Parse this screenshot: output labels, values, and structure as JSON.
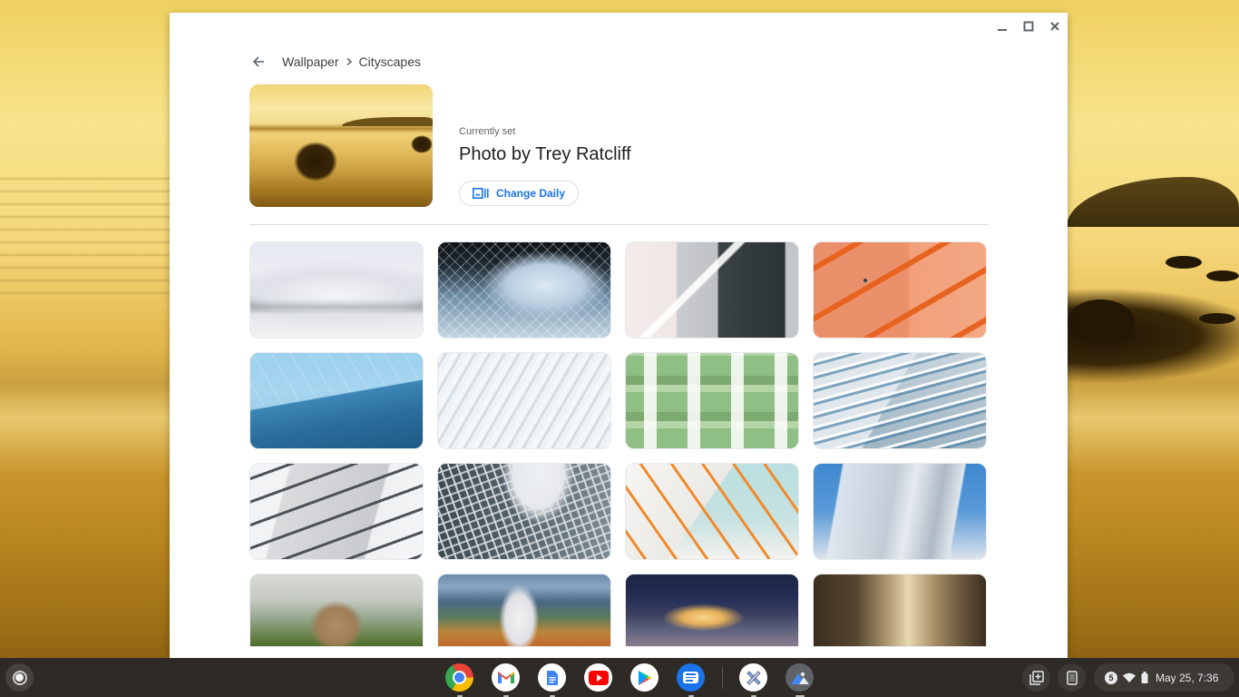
{
  "window": {
    "controls": {
      "minimize": "minimize",
      "maximize": "maximize",
      "close": "close"
    }
  },
  "header": {
    "back_icon": "arrow-back-icon",
    "breadcrumb": [
      "Wallpaper",
      "Cityscapes"
    ]
  },
  "current": {
    "label": "Currently set",
    "title": "Photo by Trey Ratcliff",
    "change_daily_label": "Change Daily",
    "change_daily_icon": "change-daily-icon"
  },
  "collection": {
    "name": "Cityscapes",
    "tiles": [
      {
        "subject": "white curved building facade"
      },
      {
        "subject": "glass lattice dome skylight"
      },
      {
        "subject": "exterior staircase on dark facade"
      },
      {
        "subject": "orange building with fire escapes"
      },
      {
        "subject": "blue glass triangular roof"
      },
      {
        "subject": "white curved ribs"
      },
      {
        "subject": "green angled balconies"
      },
      {
        "subject": "white layered curved building"
      },
      {
        "subject": "white angular building with slot windows"
      },
      {
        "subject": "curving steel lattice towers"
      },
      {
        "subject": "white stairs with orange railings"
      },
      {
        "subject": "stainless steel curved concert hall"
      },
      {
        "subject": "castle on hill in clouds"
      },
      {
        "subject": "white castle before mountains"
      },
      {
        "subject": "illuminated old town at night"
      },
      {
        "subject": "sepia narrow street"
      }
    ]
  },
  "shelf": {
    "launcher": "launcher-icon",
    "apps": [
      {
        "name": "Chrome",
        "icon": "chrome-icon"
      },
      {
        "name": "Gmail",
        "icon": "gmail-icon"
      },
      {
        "name": "Docs",
        "icon": "docs-icon"
      },
      {
        "name": "YouTube",
        "icon": "youtube-icon"
      },
      {
        "name": "Play Store",
        "icon": "play-store-icon"
      },
      {
        "name": "Messages",
        "icon": "messages-icon"
      },
      {
        "name": "Explore",
        "icon": "explore-icon"
      },
      {
        "name": "Wallpaper",
        "icon": "wallpaper-app-icon"
      }
    ],
    "tray": {
      "holding_space": "holding-space-icon",
      "phone_hub": "phone-hub-icon",
      "notification_count": "5",
      "wifi": "wifi-icon",
      "battery": "battery-icon",
      "datetime": "May 25, 7:36"
    }
  },
  "colors": {
    "accent": "#1a73e8",
    "divider": "#dadce0",
    "shelf": "#2e2a26"
  }
}
